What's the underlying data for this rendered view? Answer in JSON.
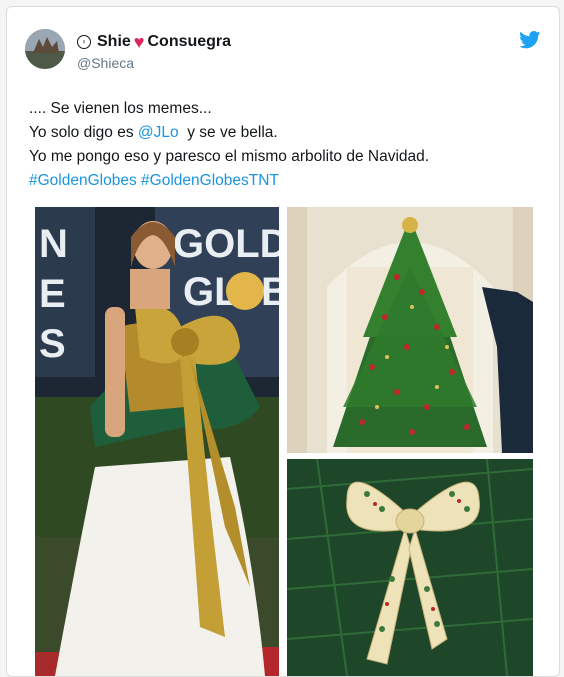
{
  "user": {
    "name_first": "Shie",
    "name_second": "Consuegra",
    "heart": "♥",
    "verified_badge": "♀",
    "handle": "@Shieca"
  },
  "tweet": {
    "line1": ".... Se vienen los memes...",
    "line2_prefix": "Yo solo digo es ",
    "line2_mention": "@JLo",
    "line2_suffix": "  y se ve bella.",
    "line3": "Yo me pongo eso y paresco el mismo arbolito de Navidad.",
    "hashtag1": "#GoldenGlobes",
    "hashtag2": "#GoldenGlobesTNT"
  },
  "media": {
    "backdrop_text_line1": "GOLDE",
    "backdrop_text_line2_a": "GL",
    "backdrop_text_line2_b": "B",
    "side_text_1": "N",
    "side_text_2": "E",
    "side_text_3": "S"
  },
  "colors": {
    "link": "#1b95e0",
    "heart": "#e0245e",
    "twitter_blue": "#1da1f2"
  }
}
